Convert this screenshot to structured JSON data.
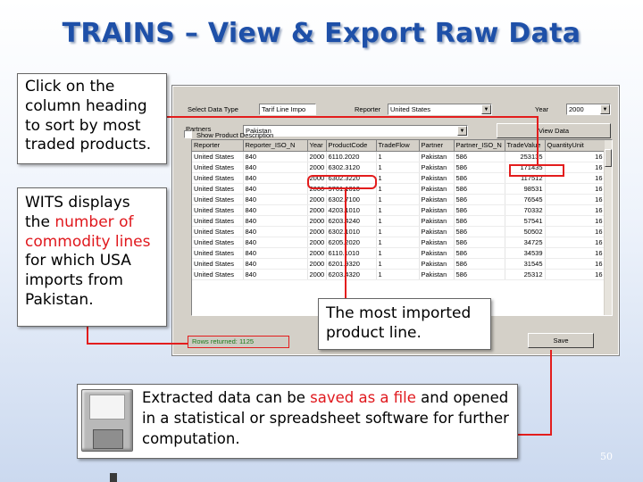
{
  "slide": {
    "title": "TRAINS – View & Export Raw Data",
    "page_number": "50"
  },
  "callouts": {
    "sort_hint": "Click on the column heading to sort by most traded products.",
    "wits_pre": "WITS displays the ",
    "wits_hl": "number of commodity lines",
    "wits_post": " for which USA imports from Pakistan.",
    "most_imported": "The most imported product line.",
    "extract_pre": "Extracted data can be ",
    "extract_hl": "saved as a file",
    "extract_post": " and opened in a statistical or spreadsheet software for further computation."
  },
  "window": {
    "select_data_type_label": "Select Data Type",
    "select_data_type_value": "Tarif Line Impo",
    "reporter_label": "Reporter",
    "reporter_value": "United States",
    "year_label": "Year",
    "year_value": "2000",
    "partners_label": "Partners",
    "partners_value": "Pakistan",
    "view_data_button": "View Data",
    "show_desc_label": "Show Product Description",
    "status_text": "Rows returned: 1125",
    "save_button": "Save",
    "columns": [
      "Reporter",
      "Reporter_ISO_N",
      "Year",
      "ProductCode",
      "TradeFlow",
      "Partner",
      "Partner_ISO_N",
      "TradeValue",
      "QuantityUnit"
    ],
    "rows": [
      [
        "United States",
        "840",
        "2000",
        "6110.2020",
        "1",
        "Pakistan",
        "586",
        "253135",
        "16"
      ],
      [
        "United States",
        "840",
        "2000",
        "6302.3120",
        "1",
        "Pakistan",
        "586",
        "171435",
        "16"
      ],
      [
        "United States",
        "840",
        "2000",
        "6302.3220",
        "1",
        "Pakistan",
        "586",
        "117512",
        "16"
      ],
      [
        "United States",
        "840",
        "2000",
        "5701.1010",
        "1",
        "Pakistan",
        "586",
        "98531",
        "16"
      ],
      [
        "United States",
        "840",
        "2000",
        "6302.7100",
        "1",
        "Pakistan",
        "586",
        "76545",
        "16"
      ],
      [
        "United States",
        "840",
        "2000",
        "4203.1010",
        "1",
        "Pakistan",
        "586",
        "70332",
        "16"
      ],
      [
        "United States",
        "840",
        "2000",
        "6203.4240",
        "1",
        "Pakistan",
        "586",
        "57541",
        "16"
      ],
      [
        "United States",
        "840",
        "2000",
        "6302.1010",
        "1",
        "Pakistan",
        "586",
        "50502",
        "16"
      ],
      [
        "United States",
        "840",
        "2000",
        "6205.2020",
        "1",
        "Pakistan",
        "586",
        "34725",
        "16"
      ],
      [
        "United States",
        "840",
        "2000",
        "6110.1010",
        "1",
        "Pakistan",
        "586",
        "34539",
        "16"
      ],
      [
        "United States",
        "840",
        "2000",
        "6201.9320",
        "1",
        "Pakistan",
        "586",
        "31545",
        "16"
      ],
      [
        "United States",
        "840",
        "2000",
        "6203.4320",
        "1",
        "Pakistan",
        "586",
        "25312",
        "16"
      ]
    ]
  },
  "colors": {
    "title_blue": "#1e50a8",
    "highlight_red": "#e0181d",
    "status_green": "#1a7a1a"
  },
  "icons": {
    "save_graphic": "floppy-disk-icon"
  }
}
